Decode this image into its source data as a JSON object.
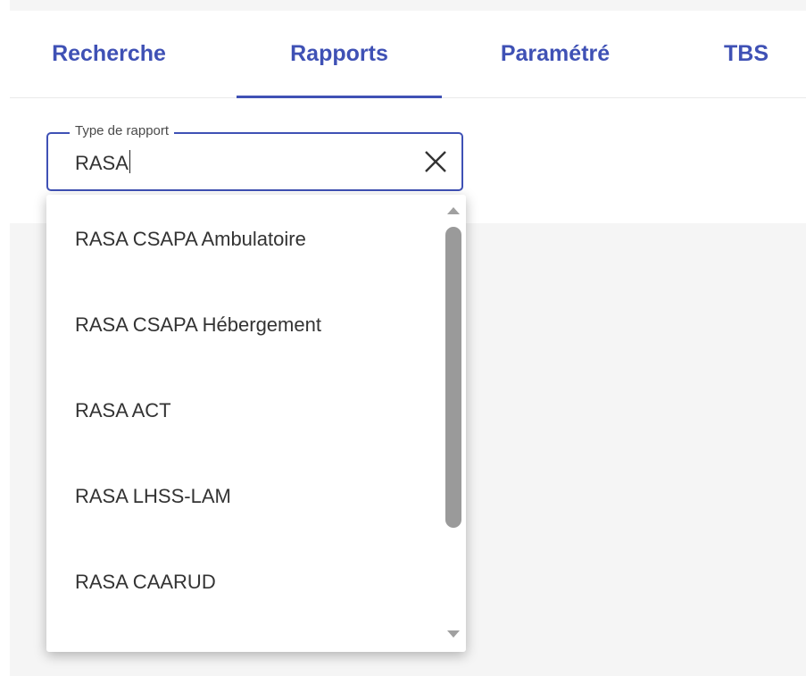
{
  "nav": {
    "tabs": [
      {
        "label": "Recherche"
      },
      {
        "label": "Rapports"
      },
      {
        "label": "Paramétré"
      },
      {
        "label": "TBS"
      }
    ],
    "active_tab": "Rapports"
  },
  "report_type_field": {
    "label": "Type de rapport",
    "value": "RASA"
  },
  "dropdown": {
    "options": [
      "RASA CSAPA Ambulatoire",
      "RASA CSAPA Hébergement",
      "RASA ACT",
      "RASA LHSS-LAM",
      "RASA CAARUD"
    ]
  },
  "colors": {
    "accent": "#3f51b5",
    "text": "#333333",
    "scrollbar": "#9a9a9a",
    "background": "#f5f5f5"
  },
  "icons": {
    "clear": "close-icon",
    "scroll_up": "arrow-up-icon",
    "scroll_down": "arrow-down-icon"
  }
}
